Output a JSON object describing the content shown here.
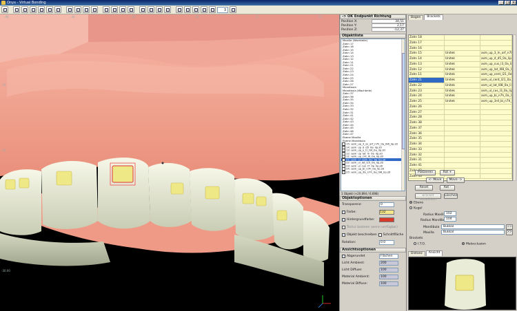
{
  "window": {
    "title": "Onyx - Virtual Bonding"
  },
  "toolbar": {
    "zoom_value": "3"
  },
  "viewport": {
    "ruler_labels": [
      "-40",
      "-30",
      "-20",
      "-10",
      "0",
      "10",
      "-20",
      "-10"
    ],
    "corner_label": "-30.00"
  },
  "endpoint_panel": {
    "title": "-> OK Endpunkt Richtung",
    "rows": [
      {
        "label": "Position X:",
        "value": "34,51"
      },
      {
        "label": "Position Y:",
        "value": "2,17"
      },
      {
        "label": "Position Z:",
        "value": "-12,37"
      }
    ]
  },
  "object_list": {
    "title": "Objektliste",
    "items": [
      "Maxilla (Wachteile)",
      "Zahn 17",
      "Zahn 16",
      "Zahn 15",
      "Zahn 14",
      "Zahn 13",
      "Zahn 12",
      "Zahn 11",
      "Zahn 21",
      "Zahn 22",
      "Zahn 23",
      "Zahn 24",
      "Zahn 25",
      "Zahn 26",
      "Zahn 27",
      "Mandibula",
      "Mandibula (Wachteile)",
      "Zahn 37",
      "Zahn 36",
      "Zahn 35",
      "Zahn 34",
      "Zahn 33",
      "Zahn 32",
      "Zahn 31",
      "Zahn 41",
      "Zahn 42",
      "Zahn 43",
      "Zahn 44",
      "Zahn 45",
      "Zahn 46",
      "Zahn 47",
      "Ebene Maxilla",
      "Ebene Mandibula",
      "15: asm_up_3_ss_orf_n7h_0a_l96_lip.stl",
      "14: asm_up_d_d5_0a_lip.stl",
      "13: asm_up_u_tr_l9t_0a_lip.stl",
      "12: asm_up_lat_ln_0a_lip.stl",
      "11: asm_up_cnt_l0_0a_lip.stl",
      "21: asm_ul_cent_l21_0a_lip.stl",
      "22: asm_ul_lat_l25_0a_lip.stl",
      "23: asm_ul_cus_l7_0a_lip.stl",
      "24: asm_up_bi_n7h_0a_lip.stl",
      "25: asm_up_3b_n7h_0a_l96_lip.stl"
    ],
    "selected_index": 38,
    "count_text": "1 Objekt (+20.894 / 6.698)"
  },
  "object_options": {
    "title": "Objektoptionen",
    "transparency_label": "Transparenz:",
    "transparency_value": "0",
    "color_label": "Farbe:",
    "color_value": "132",
    "color_swatch": "#f6e88a",
    "bgcolor_label": "Hintergrundfarbe:",
    "bgcolor_value": "",
    "bgcolor_swatch": "#d83a2a",
    "texture_label": "Textur basteen (wenn verfügbar)",
    "describe_label": "Objekt beschreiben",
    "cut_label": "Schnittfläche",
    "rotation_label": "Rotation:",
    "rotation_value": "0.0"
  },
  "view_options": {
    "title": "Ansichtsoptionen",
    "rows": [
      {
        "label": "Abgerundet",
        "value": "Flächen"
      },
      {
        "label": "Licht Ambient:",
        "value": "200"
      },
      {
        "label": "Licht Diffuse:",
        "value": "100"
      },
      {
        "label": "Material Ambient:",
        "value": "100"
      },
      {
        "label": "Material Diffuse:",
        "value": "100"
      }
    ]
  },
  "right_panel": {
    "tabs": [
      "Bogen",
      "Brackets"
    ],
    "active_tab": 1,
    "grid_rows": [
      [
        "Zahn 18",
        "",
        ""
      ],
      [
        "Zahn 17",
        "",
        ""
      ],
      [
        "Zahn 16",
        "",
        ""
      ],
      [
        "Zahn 15",
        "Unitek",
        "asm_up_3_ln_orf_n7h_0a"
      ],
      [
        "Zahn 14",
        "Unitek",
        "asm_up_d_d5_0a_lip"
      ],
      [
        "Zahn 13",
        "Unitek",
        "asm_up_cus_l3_0a_lip"
      ],
      [
        "Zahn 12",
        "Unitek",
        "asm_up_lat_l08_0a_lip"
      ],
      [
        "Zahn 11",
        "Unitek",
        "asm_up_cent_l21_0a_lip"
      ],
      [
        "Zahn 21",
        "Unitek",
        "asm_ul_cent_l21_0a_lip"
      ],
      [
        "Zahn 22",
        "Unitek",
        "asm_ul_lat_l08_0a_lip"
      ],
      [
        "Zahn 23",
        "Unitek",
        "asm_ul_cus_l3_0a_lip"
      ],
      [
        "Zahn 24",
        "Unitek",
        "asm_up_bi_n7h_0a_lip"
      ],
      [
        "Zahn 25",
        "Unitek",
        "asm_up_3rd_bi_n7h_0"
      ],
      [
        "Zahn 26",
        "",
        ""
      ],
      [
        "Zahn 27",
        "",
        ""
      ],
      [
        "Zahn 28",
        "",
        ""
      ],
      [
        "Zahn 38",
        "",
        ""
      ],
      [
        "Zahn 37",
        "",
        ""
      ],
      [
        "Zahn 36",
        "",
        ""
      ],
      [
        "Zahn 35",
        "",
        ""
      ],
      [
        "Zahn 34",
        "",
        ""
      ],
      [
        "Zahn 33",
        "",
        ""
      ],
      [
        "Zahn 32",
        "",
        ""
      ],
      [
        "Zahn 31",
        "",
        ""
      ],
      [
        "Zahn 41",
        "",
        ""
      ],
      [
        "Zahn 42",
        "",
        ""
      ],
      [
        "Zahn 43",
        "",
        ""
      ]
    ],
    "selected_row": 8,
    "buttons": {
      "platzieren": "Platzieren",
      "rot_plus": "Rot +",
      "move_left": "<- Move",
      "move_right": "Move ->",
      "reset": "Reset",
      "rot_minus": "Rot -",
      "bracket_auswaehlen": "Bracket auswählen",
      "loeschen": "Löschen"
    },
    "ebene_label": "Ebene",
    "kugel_label": "Kugel",
    "radius_maxilla_label": "Radius Maxilla:",
    "radius_maxilla_value": "102",
    "radius_mandibula_label": "Radius Mandibula:",
    "radius_mandibula_value": "104",
    "mandibula_label": "Mandibula",
    "mandibula_value": "Bukkal",
    "maxilla_label": "Maxilla",
    "maxilla_value": "Bukkal",
    "brackets_label": "Brackets",
    "ito_label": "I.T.O.",
    "malocclusion_label": "Malocclusion",
    "preview_tabs": [
      "Distanz",
      "Ansicht"
    ],
    "preview_active": 1
  },
  "colors": {
    "gum": "#f2a493",
    "tooth": "#e9ecd6",
    "bracket": "#efe887",
    "selection": "#316ac5",
    "grid_bg": "#fffccc"
  }
}
